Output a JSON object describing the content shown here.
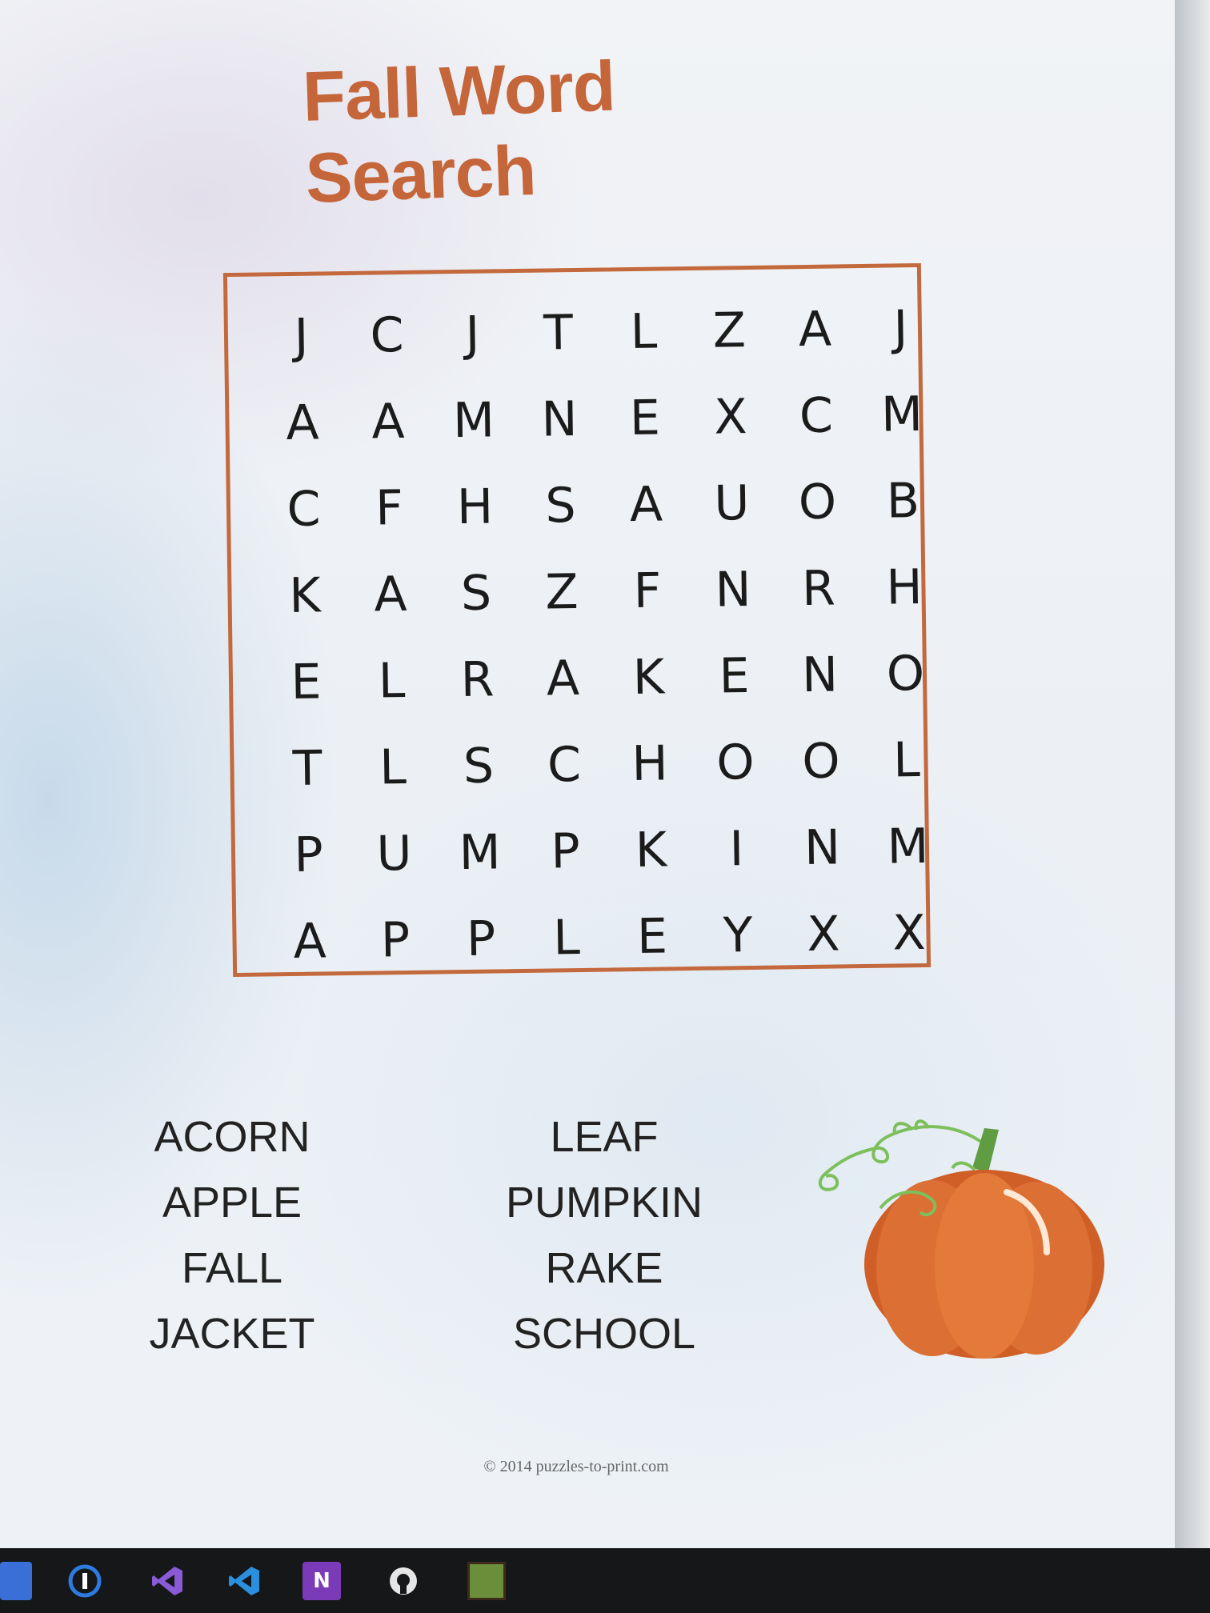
{
  "page": {
    "title": "Fall Word Search",
    "copyright": "© 2014 puzzles-to-print.com"
  },
  "grid": [
    [
      "J",
      "C",
      "J",
      "T",
      "L",
      "Z",
      "A",
      "J"
    ],
    [
      "A",
      "A",
      "M",
      "N",
      "E",
      "X",
      "C",
      "M"
    ],
    [
      "C",
      "F",
      "H",
      "S",
      "A",
      "U",
      "O",
      "B"
    ],
    [
      "K",
      "A",
      "S",
      "Z",
      "F",
      "N",
      "R",
      "H"
    ],
    [
      "E",
      "L",
      "R",
      "A",
      "K",
      "E",
      "N",
      "O"
    ],
    [
      "T",
      "L",
      "S",
      "C",
      "H",
      "O",
      "O",
      "L"
    ],
    [
      "P",
      "U",
      "M",
      "P",
      "K",
      "I",
      "N",
      "M"
    ],
    [
      "A",
      "P",
      "P",
      "L",
      "E",
      "Y",
      "X",
      "X"
    ]
  ],
  "words": {
    "col1": [
      "ACORN",
      "APPLE",
      "FALL",
      "JACKET"
    ],
    "col2": [
      "LEAF",
      "PUMPKIN",
      "RAKE",
      "SCHOOL"
    ]
  },
  "taskbar": {
    "icons": [
      {
        "name": "start-icon",
        "color": "#3a6fd8"
      },
      {
        "name": "1password-icon",
        "color": "#2d7be0"
      },
      {
        "name": "visual-studio-icon",
        "color": "#8a5bd6"
      },
      {
        "name": "vscode-icon",
        "color": "#2b8fe0"
      },
      {
        "name": "onenote-icon",
        "color": "#7b3bb8"
      },
      {
        "name": "github-icon",
        "color": "#e6e6e6"
      },
      {
        "name": "minecraft-icon",
        "color": "#6b8e3a"
      }
    ],
    "onenote_letter": "N"
  },
  "colors": {
    "title": "#c5653a",
    "frame": "#c4693d",
    "pumpkin": "#d9692e",
    "stem": "#6aa84f"
  }
}
